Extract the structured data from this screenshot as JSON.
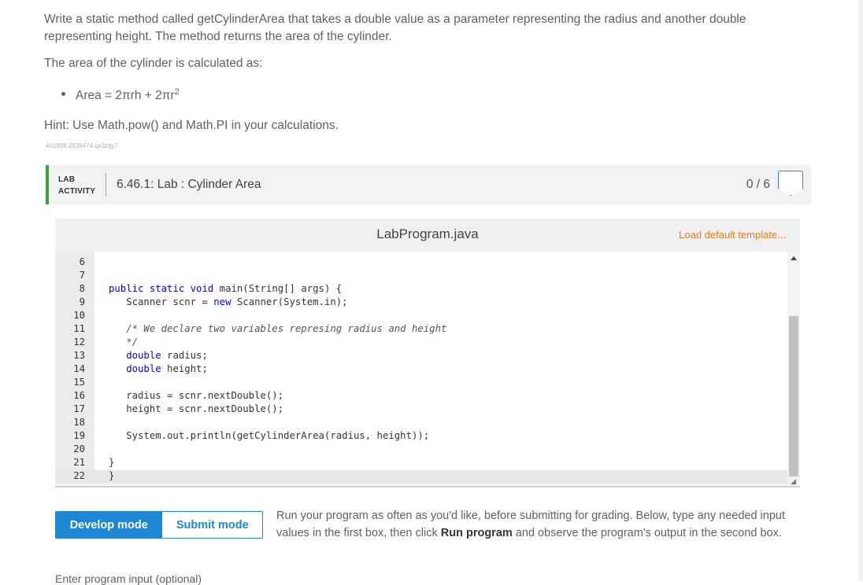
{
  "prompt": {
    "paragraph1": "Write a static method called getCylinderArea that takes a double value as a parameter representing the radius and another double representing height. The method returns the area of the cylinder.",
    "paragraph2": "The area of the cylinder is calculated as:",
    "formula_prefix": "Area = 2πrh + 2πr",
    "formula_exponent": "2",
    "hint": "Hint: Use Math.pow() and Math.PI in your calculations.",
    "code_id": "401808.2836474.qx3zqy7"
  },
  "lab": {
    "tag_line1": "LAB",
    "tag_line2": "ACTIVITY",
    "title": "6.46.1: Lab : Cylinder Area",
    "score": "0 / 6"
  },
  "editor": {
    "filename": "LabProgram.java",
    "load_default": "Load default template...",
    "lines": [
      {
        "num": "6",
        "text": ""
      },
      {
        "num": "7",
        "text": ""
      },
      {
        "num": "8",
        "text": "public static void main(String[] args) {"
      },
      {
        "num": "9",
        "text": "   Scanner scnr = new Scanner(System.in);"
      },
      {
        "num": "10",
        "text": ""
      },
      {
        "num": "11",
        "text": "   /* We declare two variables represing radius and height"
      },
      {
        "num": "12",
        "text": "   */"
      },
      {
        "num": "13",
        "text": "   double radius;"
      },
      {
        "num": "14",
        "text": "   double height;"
      },
      {
        "num": "15",
        "text": ""
      },
      {
        "num": "16",
        "text": "   radius = scnr.nextDouble();"
      },
      {
        "num": "17",
        "text": "   height = scnr.nextDouble();"
      },
      {
        "num": "18",
        "text": ""
      },
      {
        "num": "19",
        "text": "   System.out.println(getCylinderArea(radius, height));"
      },
      {
        "num": "20",
        "text": ""
      },
      {
        "num": "21",
        "text": "}"
      },
      {
        "num": "22",
        "text": "}"
      }
    ]
  },
  "modes": {
    "develop": "Develop mode",
    "submit": "Submit mode"
  },
  "run_info": {
    "part1": "Run your program as often as you'd like, before submitting for grading. Below, type any needed input values in the first box, then click ",
    "bold": "Run program",
    "part2": " and observe the program's output in the second box."
  },
  "input_label": "Enter program input (optional)"
}
